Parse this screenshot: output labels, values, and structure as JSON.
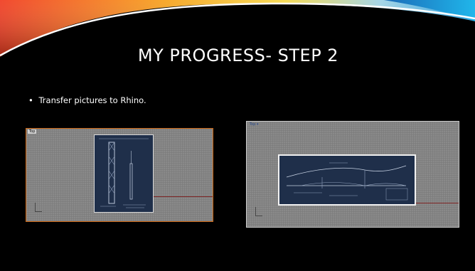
{
  "slide": {
    "title": "MY PROGRESS- STEP 2",
    "bullets": [
      {
        "symbol": "•",
        "text": "Transfer pictures to Rhino."
      }
    ]
  },
  "viewports": [
    {
      "label": "Top",
      "accent_color": "#d06a16"
    },
    {
      "label": "Top ▾",
      "accent_color": "#cfcfcf"
    }
  ],
  "colors": {
    "background": "#000000",
    "title_text": "#ffffff",
    "blueprint": "#1f2f4a"
  }
}
